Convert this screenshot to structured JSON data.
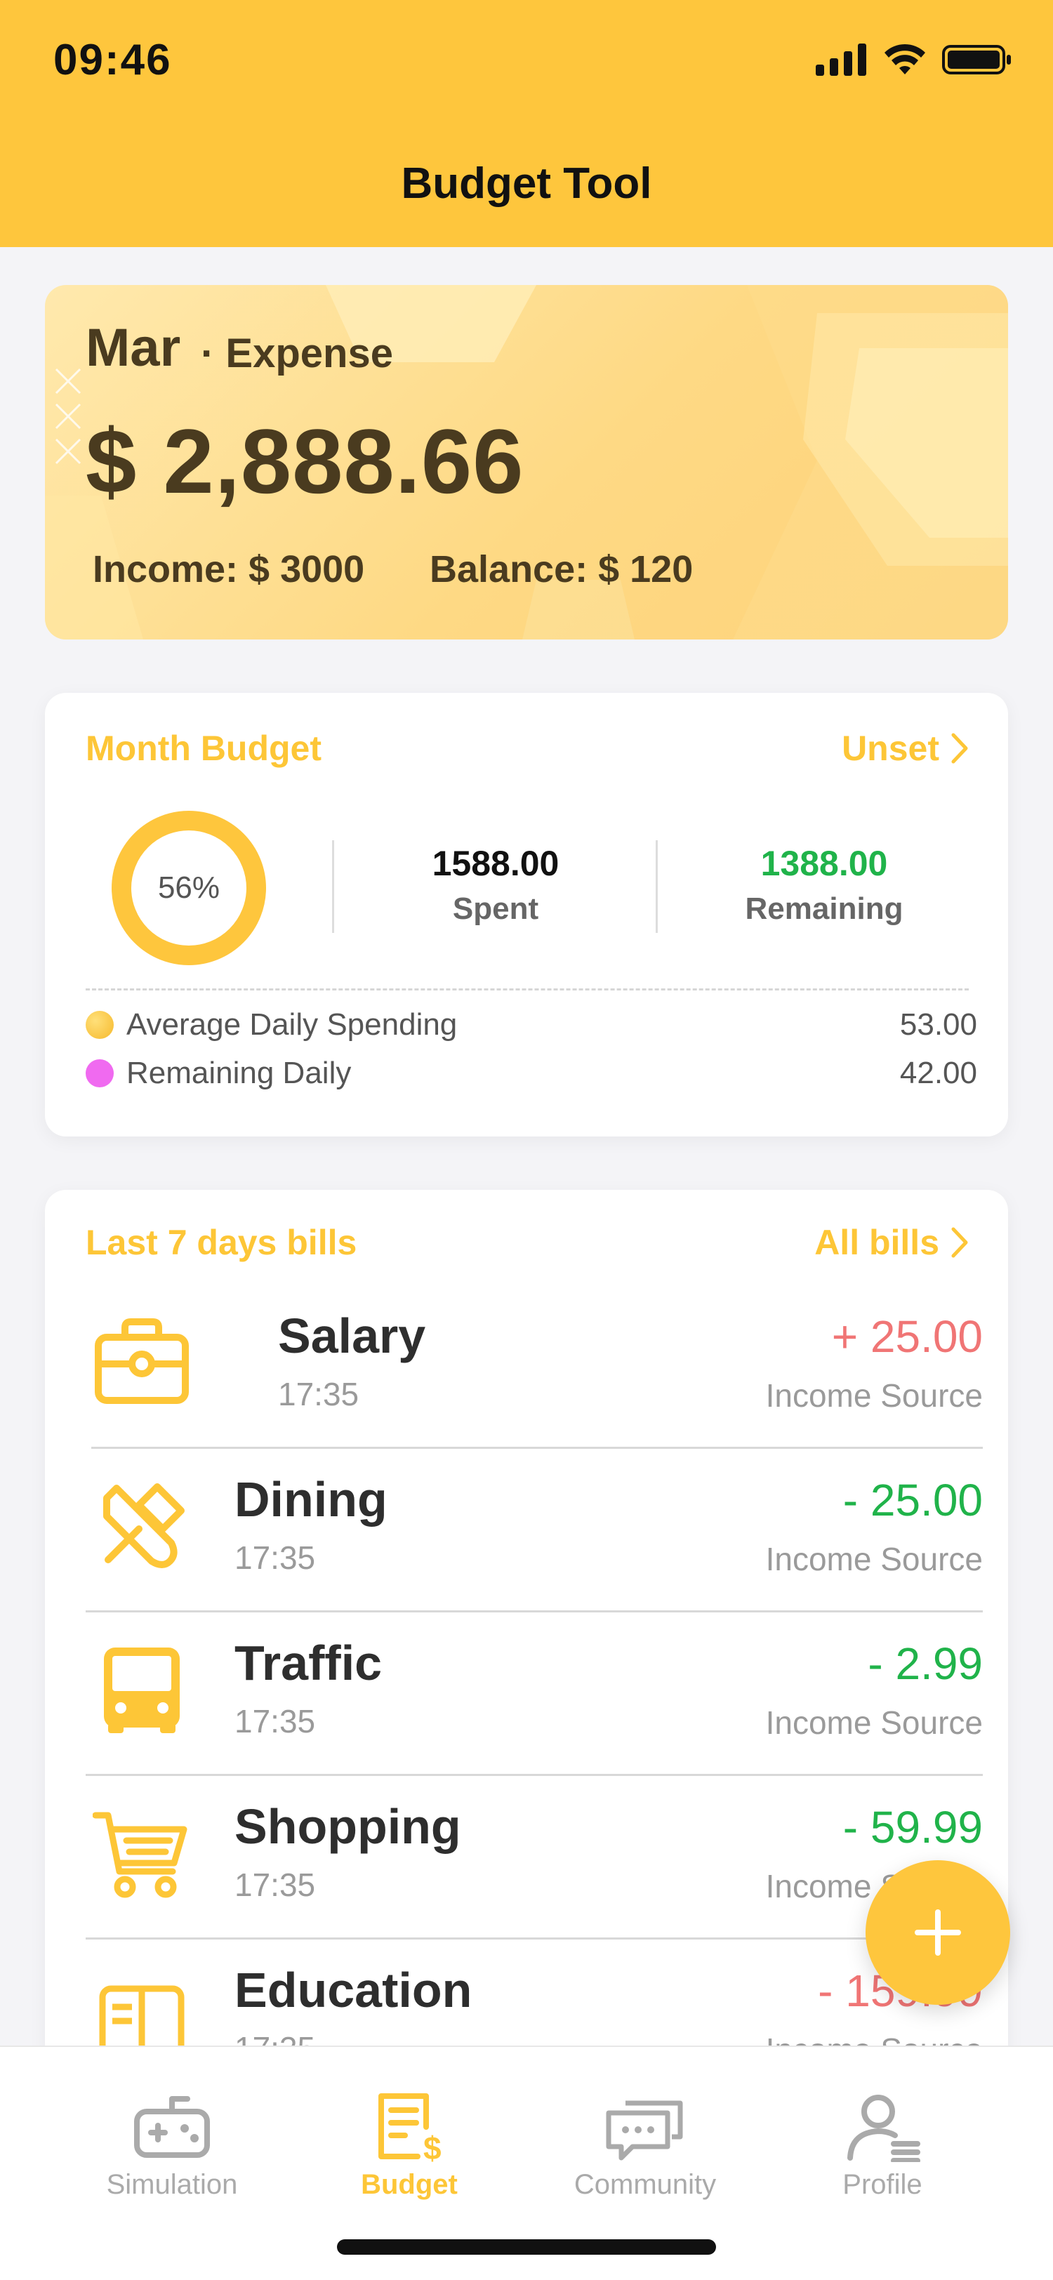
{
  "status_bar": {
    "time": "09:46"
  },
  "header": {
    "title": "Budget Tool"
  },
  "expense_card": {
    "month": "Mar",
    "label": "· Expense",
    "amount": "$ 2,888.66",
    "income": "Income: $ 3000",
    "balance": "Balance: $ 120"
  },
  "month_budget": {
    "title": "Month Budget",
    "link_label": "Unset",
    "progress_percent": 56,
    "progress_text": "56%",
    "spent_value": "1588.00",
    "spent_label": "Spent",
    "remaining_value": "1388.00",
    "remaining_label": "Remaining",
    "legend": [
      {
        "label": "Average Daily Spending",
        "value": "53.00",
        "color": "#fdc637"
      },
      {
        "label": "Remaining Daily",
        "value": "42.00",
        "color": "#f06af0"
      }
    ]
  },
  "bills": {
    "title": "Last 7 days bills",
    "link_label": "All bills",
    "items": [
      {
        "name": "Salary",
        "time": "17:35",
        "amount": "+ 25.00",
        "source": "Income Source",
        "icon": "briefcase-icon"
      },
      {
        "name": "Dining",
        "time": "17:35",
        "amount": "- 25.00",
        "source": "Income Source",
        "icon": "utensils-icon"
      },
      {
        "name": "Traffic",
        "time": "17:35",
        "amount": "- 2.99",
        "source": "Income Source",
        "icon": "bus-icon"
      },
      {
        "name": "Shopping",
        "time": "17:35",
        "amount": "- 59.99",
        "source": "Income Source",
        "icon": "cart-icon"
      },
      {
        "name": "Education",
        "time": "17:35",
        "amount": "- 159.99",
        "source": "Income Source",
        "icon": "book-icon"
      }
    ]
  },
  "fab": {
    "icon": "plus-icon"
  },
  "tabbar": {
    "tabs": [
      {
        "label": "Simulation",
        "icon": "gamepad-icon"
      },
      {
        "label": "Budget",
        "icon": "budget-doc-icon"
      },
      {
        "label": "Community",
        "icon": "chat-icon"
      },
      {
        "label": "Profile",
        "icon": "user-icon"
      }
    ],
    "active_tab": "Budget"
  },
  "colors": {
    "primary": "#fec63d",
    "accent_text": "#fdc637",
    "income_red": "#f07575",
    "expense_green": "#20b34a"
  }
}
